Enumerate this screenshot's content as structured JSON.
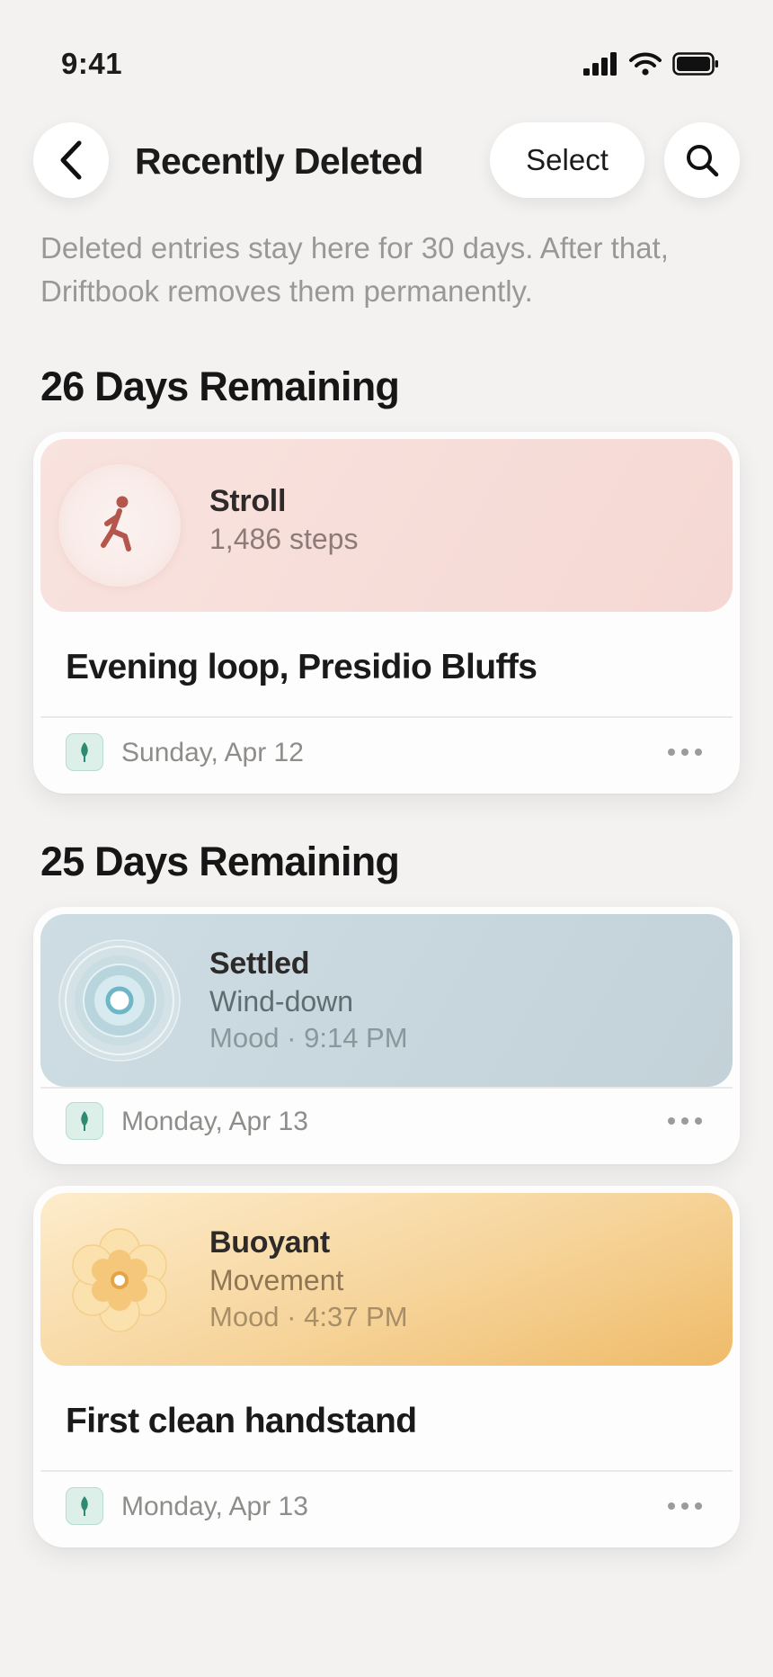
{
  "status_bar": {
    "time": "9:41"
  },
  "header": {
    "title": "Recently Deleted",
    "select_label": "Select"
  },
  "description": "Deleted entries stay here for 30 days. After that, Driftbook removes them permanently.",
  "sections": [
    {
      "heading": "26 Days Remaining",
      "entries": [
        {
          "title": "Stroll",
          "subtitle": "1,486 steps",
          "headline": "Evening loop, Presidio Bluffs",
          "date": "Sunday, Apr 12",
          "icon": "walking-figure-icon"
        }
      ]
    },
    {
      "heading": "25 Days Remaining",
      "entries": [
        {
          "title": "Settled",
          "subtitle": "Wind-down",
          "meta": "Mood · 9:14 PM",
          "date": "Monday, Apr 13",
          "icon": "concentric-rings-icon"
        },
        {
          "title": "Buoyant",
          "subtitle": "Movement",
          "meta": "Mood · 4:37 PM",
          "headline": "First clean handstand",
          "date": "Monday, Apr 13",
          "icon": "flower-icon"
        }
      ]
    }
  ],
  "colors": {
    "background": "#f3f2f1",
    "stroll_banner": "#f7ddd8",
    "settled_banner": "#c8d8de",
    "buoyant_banner": "#f6d49a",
    "tag_green": "#2f8a73"
  }
}
